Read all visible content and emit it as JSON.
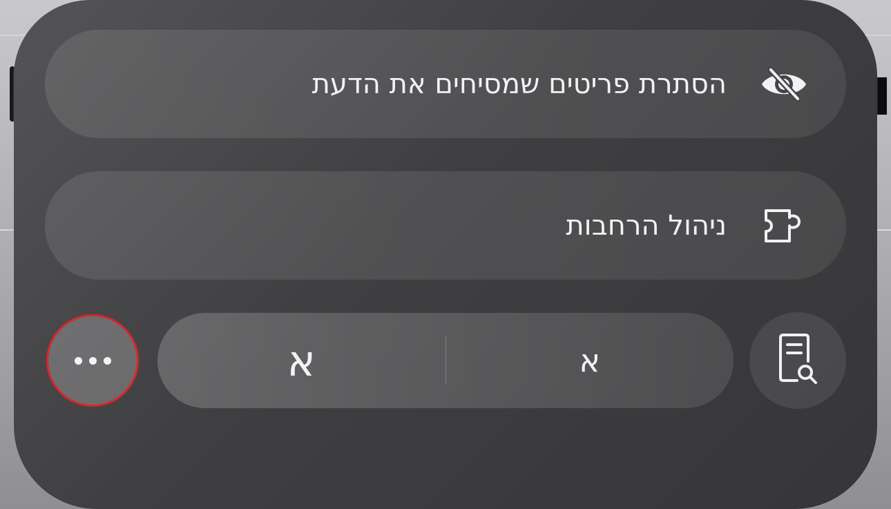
{
  "menu": {
    "hide_distracting": {
      "label": "הסתרת פריטים שמסיחים את הדעת",
      "icon": "eye-slash-icon"
    },
    "manage_extensions": {
      "label": "ניהול הרחבות",
      "icon": "puzzle-piece-icon"
    }
  },
  "toolbar": {
    "more_icon": "ellipsis-icon",
    "font_decrease_label": "א",
    "font_increase_label": "א",
    "reader_icon": "document-search-icon"
  },
  "colors": {
    "panel": "#3f3f41",
    "highlight_ring": "#d9262b",
    "text": "#f2f2f4"
  }
}
